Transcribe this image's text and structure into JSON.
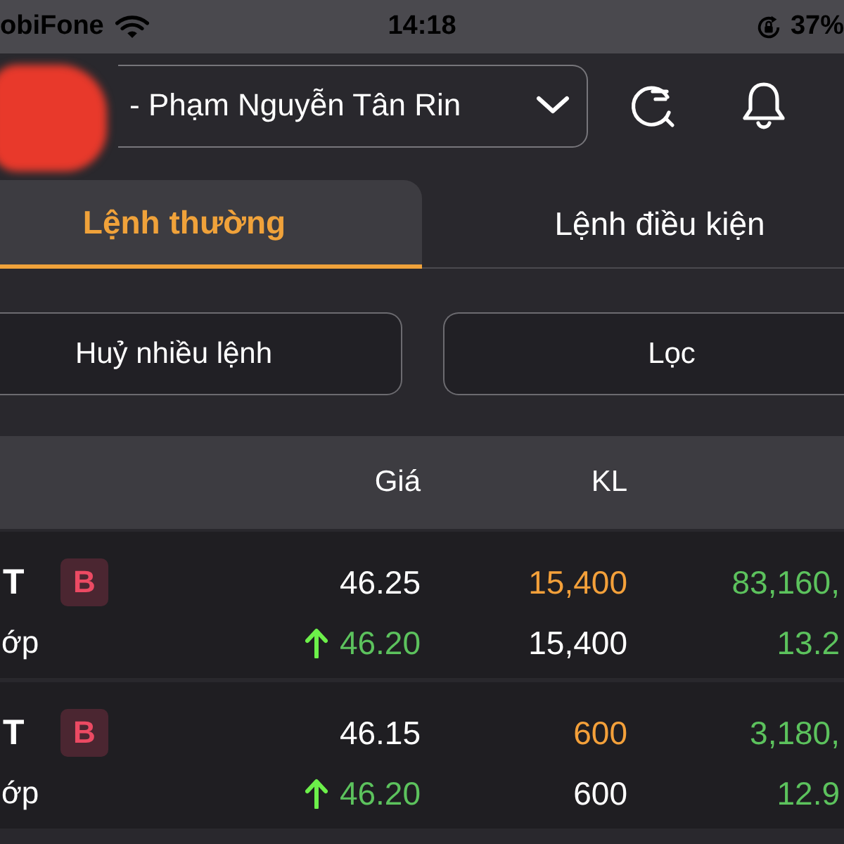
{
  "status_bar": {
    "carrier": "obiFone",
    "time": "14:18",
    "battery": "37%"
  },
  "account_select": {
    "value": "- Phạm Nguyễn Tân Rin"
  },
  "tabs": [
    {
      "label": "Lệnh thường",
      "selected": true
    },
    {
      "label": "Lệnh điều kiện",
      "selected": false
    }
  ],
  "actions": [
    "Huỷ nhiều lệnh",
    "Lọc"
  ],
  "table": {
    "columns": [
      "Giá",
      "KL"
    ],
    "rows": [
      {
        "symbol": "T",
        "side": "B",
        "price": "46.25",
        "volume": "15,400",
        "column_3": "83,160,",
        "status": "ớp",
        "rising": true,
        "matched_price": "46.20",
        "matched_volume": "15,400",
        "column_3_sub": "13.2"
      },
      {
        "symbol": "T",
        "side": "B",
        "price": "46.15",
        "volume": "600",
        "column_3": "3,180,",
        "status": "ớp",
        "rising": true,
        "matched_price": "46.20",
        "matched_volume": "600",
        "column_3_sub": "12.9"
      }
    ]
  }
}
